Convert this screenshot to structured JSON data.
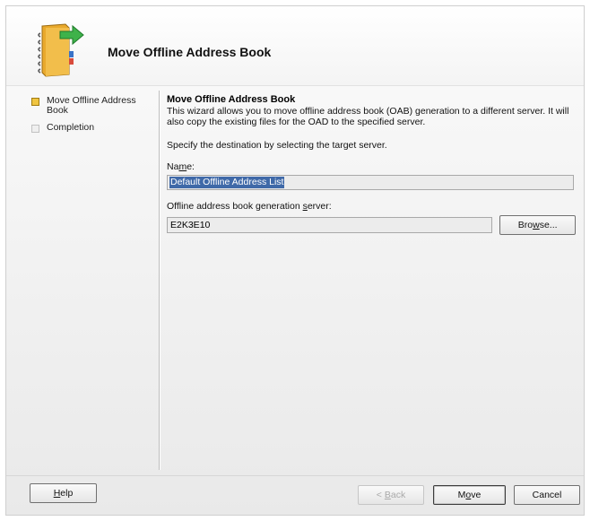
{
  "header": {
    "title": "Move Offline Address Book",
    "icon": "address-book-move-icon"
  },
  "nav": {
    "items": [
      {
        "label": "Move Offline Address Book",
        "state": "active"
      },
      {
        "label": "Completion",
        "state": "inactive"
      }
    ]
  },
  "content": {
    "title": "Move Offline Address Book",
    "description": "This wizard allows you to move offline address book (OAB) generation to a different server. It will also copy the existing files for the OAD to the specified server.",
    "instruction": "Specify the destination by selecting the target server.",
    "name_label_pre": "Na",
    "name_label_key": "m",
    "name_label_post": "e:",
    "name_value": "Default Offline Address List",
    "server_label_pre": "Offline address book generation ",
    "server_label_key": "s",
    "server_label_post": "erver:",
    "server_value": "E2K3E10",
    "browse_pre": "Bro",
    "browse_key": "w",
    "browse_post": "se..."
  },
  "footer": {
    "help_key": "H",
    "help_post": "elp",
    "back_pre": "< ",
    "back_key": "B",
    "back_post": "ack",
    "move_pre": "M",
    "move_key": "o",
    "move_post": "ve",
    "cancel_label": "Cancel"
  },
  "colors": {
    "active_step": "#f0c541",
    "selection": "#3f69a8"
  }
}
